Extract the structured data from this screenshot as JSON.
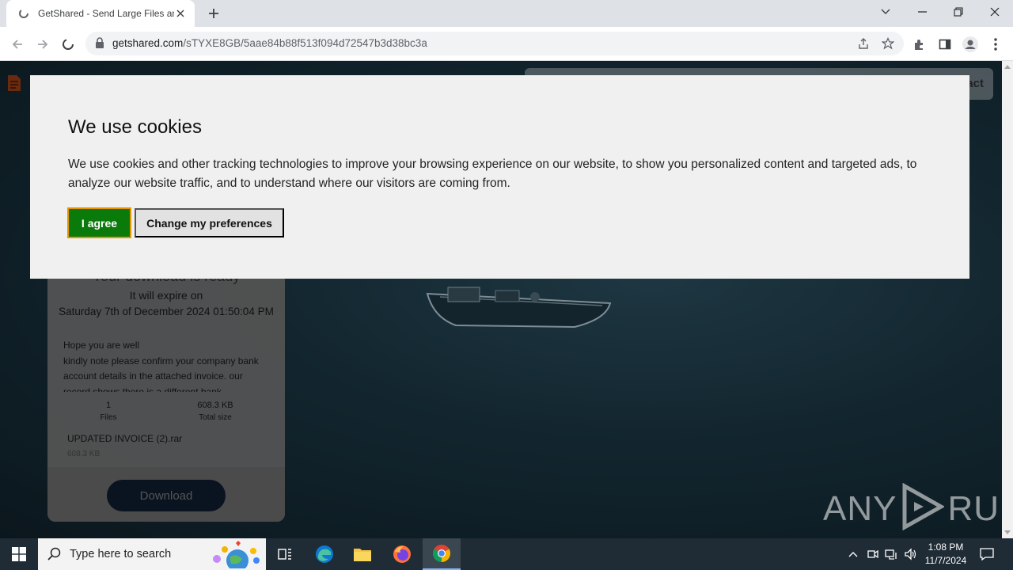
{
  "browser": {
    "tab_title": "GetShared - Send Large Files and",
    "url_domain": "getshared.com",
    "url_path": "/sTYXE8GB/5aae84b88f513f094d72547b3d38bc3a"
  },
  "site": {
    "nav_contact": "act"
  },
  "cookie_banner": {
    "title": "We use cookies",
    "description": "We use cookies and other tracking technologies to improve your browsing experience on our website, to show you personalized content and targeted ads, to analyze our website traffic, and to understand where our visitors are coming from.",
    "agree_label": "I agree",
    "prefs_label": "Change my preferences"
  },
  "download": {
    "heading": "Your download is ready",
    "expire_label": "It will expire on",
    "expire_date": "Saturday 7th of December 2024 01:50:04 PM",
    "message": "Hope you are well\nkindly note please confirm your company bank account details in the attached invoice. our record shows there is a different bank",
    "files_count": "1",
    "files_label": "Files",
    "total_size": "608.3 KB",
    "total_size_label": "Total size",
    "file_name": "UPDATED INVOICE (2).rar",
    "file_size": "608.3 KB",
    "button_label": "Download"
  },
  "watermark": {
    "text_left": "ANY",
    "text_right": "RUN"
  },
  "taskbar": {
    "search_placeholder": "Type here to search",
    "time": "1:08 PM",
    "date": "11/7/2024"
  },
  "colors": {
    "agree_green": "#0a7a0a",
    "agree_border": "#e69500",
    "taskbar_bg": "#1f2b35"
  }
}
